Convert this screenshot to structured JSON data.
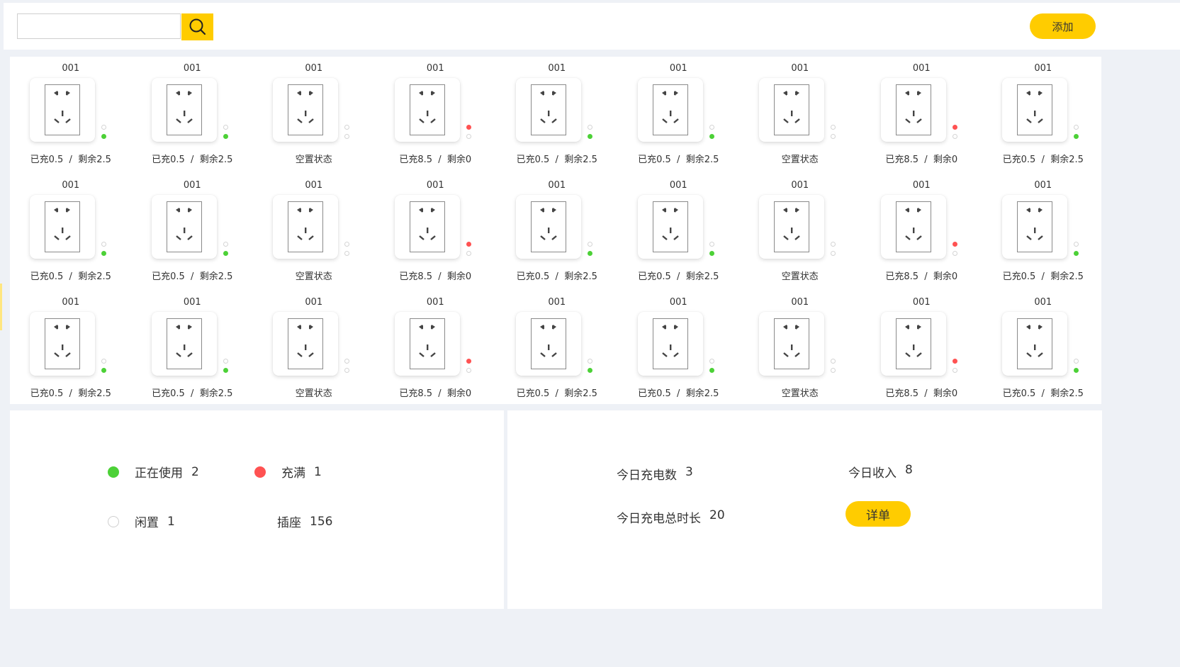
{
  "colors": {
    "accent": "#ffcc00",
    "in_use": "#4cd137",
    "full": "#ff5252",
    "idle": "#ffffff"
  },
  "header": {
    "search": {
      "placeholder": "",
      "value": "",
      "icon": "search-icon"
    },
    "add_label": "添加"
  },
  "sockets": [
    [
      {
        "id": "001",
        "status": "已充0.5  /  剩余2.5",
        "led": "green"
      },
      {
        "id": "001",
        "status": "已充0.5  /  剩余2.5",
        "led": "green"
      },
      {
        "id": "001",
        "status": "空置状态",
        "led": "idle"
      },
      {
        "id": "001",
        "status": "已充8.5  /  剩余0",
        "led": "red"
      },
      {
        "id": "001",
        "status": "已充0.5  /  剩余2.5",
        "led": "green"
      },
      {
        "id": "001",
        "status": "已充0.5  /  剩余2.5",
        "led": "green"
      },
      {
        "id": "001",
        "status": "空置状态",
        "led": "idle"
      },
      {
        "id": "001",
        "status": "已充8.5  /  剩余0",
        "led": "red"
      },
      {
        "id": "001",
        "status": "已充0.5  /  剩余2.5",
        "led": "green"
      }
    ],
    [
      {
        "id": "001",
        "status": "已充0.5  /  剩余2.5",
        "led": "green"
      },
      {
        "id": "001",
        "status": "已充0.5  /  剩余2.5",
        "led": "green"
      },
      {
        "id": "001",
        "status": "空置状态",
        "led": "idle"
      },
      {
        "id": "001",
        "status": "已充8.5  /  剩余0",
        "led": "red"
      },
      {
        "id": "001",
        "status": "已充0.5  /  剩余2.5",
        "led": "green"
      },
      {
        "id": "001",
        "status": "已充0.5  /  剩余2.5",
        "led": "green"
      },
      {
        "id": "001",
        "status": "空置状态",
        "led": "idle"
      },
      {
        "id": "001",
        "status": "已充8.5  /  剩余0",
        "led": "red"
      },
      {
        "id": "001",
        "status": "已充0.5  /  剩余2.5",
        "led": "green"
      }
    ],
    [
      {
        "id": "001",
        "status": "已充0.5  /  剩余2.5",
        "led": "green"
      },
      {
        "id": "001",
        "status": "已充0.5  /  剩余2.5",
        "led": "green"
      },
      {
        "id": "001",
        "status": "空置状态",
        "led": "idle"
      },
      {
        "id": "001",
        "status": "已充8.5  /  剩余0",
        "led": "red"
      },
      {
        "id": "001",
        "status": "已充0.5  /  剩余2.5",
        "led": "green"
      },
      {
        "id": "001",
        "status": "已充0.5  /  剩余2.5",
        "led": "green"
      },
      {
        "id": "001",
        "status": "空置状态",
        "led": "idle"
      },
      {
        "id": "001",
        "status": "已充8.5  /  剩余0",
        "led": "red"
      },
      {
        "id": "001",
        "status": "已充0.5  /  剩余2.5",
        "led": "green"
      }
    ]
  ],
  "legend": {
    "in_use": {
      "label": "正在使用",
      "value": "2"
    },
    "full": {
      "label": "充满",
      "value": "1"
    },
    "idle": {
      "label": "闲置",
      "value": "1"
    },
    "sockets": {
      "label": "插座",
      "value": "156"
    }
  },
  "today": {
    "charges": {
      "label": "今日充电数",
      "value": "3"
    },
    "income": {
      "label": "今日收入",
      "value": "8"
    },
    "duration": {
      "label": "今日充电总时长",
      "value": "20"
    },
    "detail_label": "详单"
  }
}
